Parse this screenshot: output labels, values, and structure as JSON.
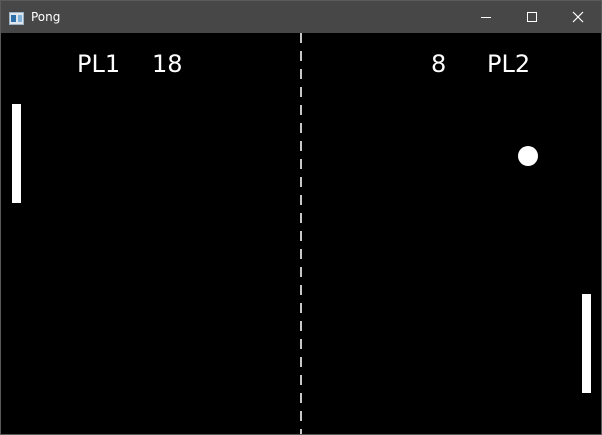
{
  "window": {
    "title": "Pong",
    "app_icon": "window-app-icon",
    "controls": {
      "minimize_icon": "minimize-icon",
      "maximize_icon": "maximize-icon",
      "close_icon": "close-icon"
    }
  },
  "scoreboard": {
    "player1": {
      "label": "PL1",
      "score": "18"
    },
    "player2": {
      "label": "PL2",
      "score": "8"
    }
  },
  "colors": {
    "titlebar": "#474747",
    "court": "#000000",
    "foreground": "#ffffff",
    "net": "#c8c8c8"
  }
}
